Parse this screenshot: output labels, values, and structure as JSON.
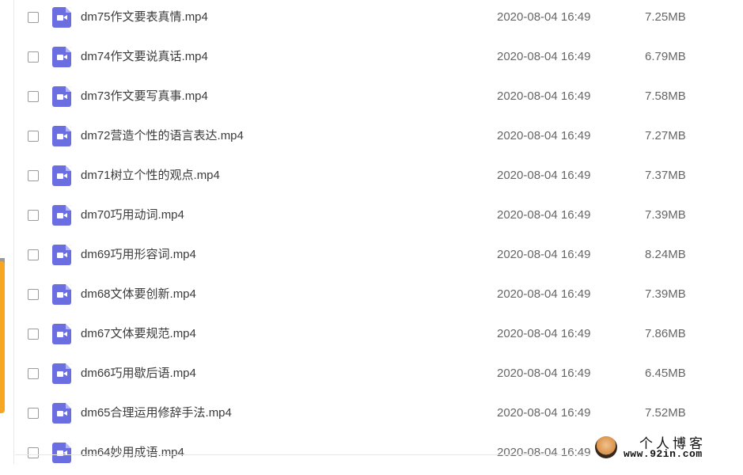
{
  "files": [
    {
      "name": "dm75作文要表真情.mp4",
      "date": "2020-08-04 16:49",
      "size": "7.25MB"
    },
    {
      "name": "dm74作文要说真话.mp4",
      "date": "2020-08-04 16:49",
      "size": "6.79MB"
    },
    {
      "name": "dm73作文要写真事.mp4",
      "date": "2020-08-04 16:49",
      "size": "7.58MB"
    },
    {
      "name": "dm72营造个性的语言表达.mp4",
      "date": "2020-08-04 16:49",
      "size": "7.27MB"
    },
    {
      "name": "dm71树立个性的观点.mp4",
      "date": "2020-08-04 16:49",
      "size": "7.37MB"
    },
    {
      "name": "dm70巧用动词.mp4",
      "date": "2020-08-04 16:49",
      "size": "7.39MB"
    },
    {
      "name": "dm69巧用形容词.mp4",
      "date": "2020-08-04 16:49",
      "size": "8.24MB"
    },
    {
      "name": "dm68文体要创新.mp4",
      "date": "2020-08-04 16:49",
      "size": "7.39MB"
    },
    {
      "name": "dm67文体要规范.mp4",
      "date": "2020-08-04 16:49",
      "size": "7.86MB"
    },
    {
      "name": "dm66巧用歇后语.mp4",
      "date": "2020-08-04 16:49",
      "size": "6.45MB"
    },
    {
      "name": "dm65合理运用修辞手法.mp4",
      "date": "2020-08-04 16:49",
      "size": "7.52MB"
    },
    {
      "name": "dm64妙用成语.mp4",
      "date": "2020-08-04 16:49",
      "size": ""
    }
  ],
  "file_icon": "video-file-icon",
  "colors": {
    "icon": "#6b6ee0",
    "text": "#3b3b3b",
    "meta_text": "#666666",
    "accent": "#f5a623"
  },
  "watermark": {
    "title": "个人博客",
    "url": "www.92in.com"
  }
}
